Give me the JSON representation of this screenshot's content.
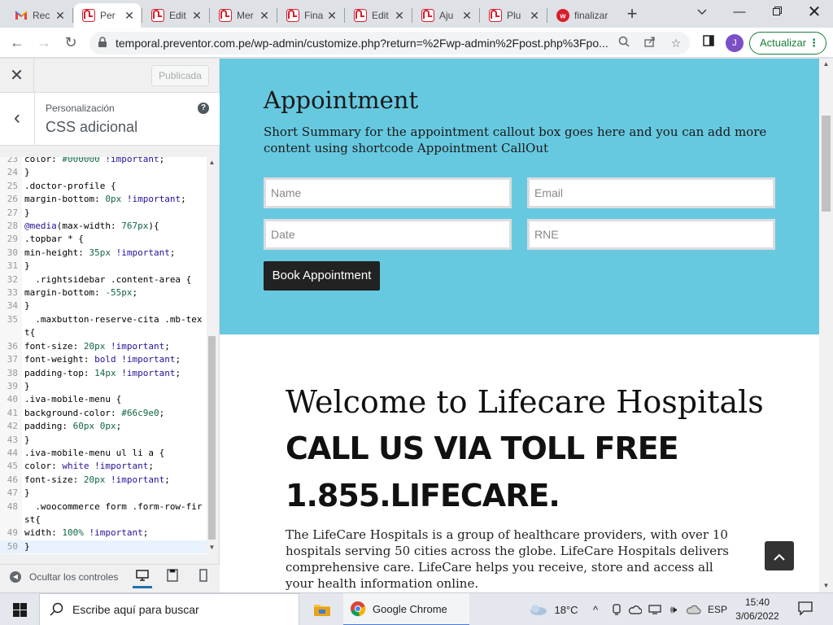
{
  "browser": {
    "tabs": [
      {
        "title": "Rec",
        "favicon": "gmail-icon",
        "active": false
      },
      {
        "title": "Per",
        "favicon": "wordpress-icon",
        "active": true
      },
      {
        "title": "Edit",
        "favicon": "wordpress-icon",
        "active": false
      },
      {
        "title": "Mer",
        "favicon": "wordpress-icon",
        "active": false
      },
      {
        "title": "Fina",
        "favicon": "wordpress-icon",
        "active": false
      },
      {
        "title": "Edit",
        "favicon": "wordpress-icon",
        "active": false
      },
      {
        "title": "Aju",
        "favicon": "wordpress-icon",
        "active": false
      },
      {
        "title": "Plu",
        "favicon": "wordpress-icon",
        "active": false
      },
      {
        "title": "finalizar",
        "favicon": "red-w-icon",
        "active": false
      }
    ],
    "url": "temporal.preventor.com.pe/wp-admin/customize.php?return=%2Fwp-admin%2Fpost.php%3Fpo...",
    "profile_initial": "J",
    "update_label": "Actualizar"
  },
  "customizer": {
    "publish_label": "Publicada",
    "breadcrumb": "Personalización",
    "section_title": "CSS adicional",
    "hide_controls_label": "Ocultar los controles",
    "code_lines": [
      {
        "n": "23",
        "t": "color: #000000 !important;"
      },
      {
        "n": "24",
        "t": "}"
      },
      {
        "n": "25",
        "t": ".doctor-profile {"
      },
      {
        "n": "26",
        "t": "margin-bottom: 0px !important;"
      },
      {
        "n": "27",
        "t": "}"
      },
      {
        "n": "28",
        "t": "@media(max-width: 767px){"
      },
      {
        "n": "29",
        "t": ".topbar * {"
      },
      {
        "n": "30",
        "t": "min-height: 35px !important;"
      },
      {
        "n": "31",
        "t": "}"
      },
      {
        "n": "32",
        "t": "  .rightsidebar .content-area {"
      },
      {
        "n": "33",
        "t": "margin-bottom: -55px;"
      },
      {
        "n": "34",
        "t": "}"
      },
      {
        "n": "35",
        "t": "  .maxbutton-reserve-cita .mb-text{"
      },
      {
        "n": "36",
        "t": "font-size: 20px !important;"
      },
      {
        "n": "37",
        "t": "font-weight: bold !important;"
      },
      {
        "n": "38",
        "t": "padding-top: 14px !important;"
      },
      {
        "n": "39",
        "t": "}"
      },
      {
        "n": "40",
        "t": ".iva-mobile-menu {"
      },
      {
        "n": "41",
        "t": "background-color: #66c9e0;"
      },
      {
        "n": "42",
        "t": "padding: 60px 0px;"
      },
      {
        "n": "43",
        "t": "}"
      },
      {
        "n": "44",
        "t": ".iva-mobile-menu ul li a {"
      },
      {
        "n": "45",
        "t": "color: white !important;"
      },
      {
        "n": "46",
        "t": "font-size: 20px !important;"
      },
      {
        "n": "47",
        "t": "}"
      },
      {
        "n": "48",
        "t": "  .woocommerce form .form-row-first{"
      },
      {
        "n": "49",
        "t": "width: 100% !important;"
      },
      {
        "n": "50",
        "t": "}"
      }
    ]
  },
  "preview": {
    "appointment_title": "Appointment",
    "appointment_summary": "Short Summary for the appointment callout box goes here and you can add more content using shortcode Appointment CallOut",
    "placeholders": {
      "name": "Name",
      "email": "Email",
      "date": "Date",
      "rne": "RNE"
    },
    "book_label": "Book Appointment",
    "welcome_heading": "Welcome to Lifecare Hospitals",
    "callus_line1": "CALL US VIA TOLL FREE",
    "callus_line2": "1.855.LIFECARE.",
    "about_text": "The LifeCare Hospitals is a group of healthcare providers, with over 10 hospitals serving 50 cities across the globe. LifeCare Hospitals delivers comprehensive care. LifeCare helps you receive, store and access all your health information online."
  },
  "taskbar": {
    "search_placeholder": "Escribe aquí para buscar",
    "chrome_label": "Google Chrome",
    "temperature": "18°C",
    "language": "ESP",
    "time": "15:40",
    "date": "3/06/2022"
  },
  "colors": {
    "appointment_bg": "#66c9e0",
    "button_bg": "#222222",
    "wp_accent": "#2271b1"
  }
}
